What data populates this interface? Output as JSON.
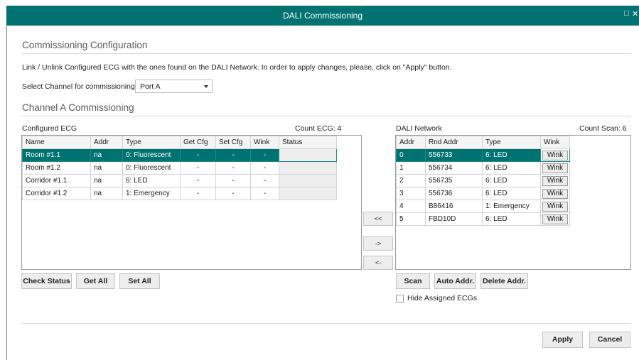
{
  "window": {
    "title": "DALI Commissioning",
    "maximize_icon": "□",
    "close_icon": "✕"
  },
  "config": {
    "heading": "Commissioning Configuration",
    "description": "Link / Unlink Configured ECG with the ones found on the DALI Network. In order to apply changes, please, click on \"Apply\" button.",
    "channel_label": "Select Channel for commissioning",
    "channel_value": "Port A"
  },
  "channel": {
    "heading": "Channel A Commissioning"
  },
  "configured": {
    "title": "Configured ECG",
    "count": "Count ECG: 4",
    "columns": [
      "Name",
      "Addr",
      "Type",
      "Get Cfg",
      "Set Cfg",
      "Wink",
      "Status"
    ],
    "rows": [
      [
        "Room #1.1",
        "na",
        "0: Fluorescent",
        "-",
        "-",
        "-",
        ""
      ],
      [
        "Room #1.2",
        "na",
        "0: Fluorescent",
        "-",
        "-",
        "-",
        ""
      ],
      [
        "Corridor #1.1",
        "na",
        "6: LED",
        "-",
        "-",
        "-",
        ""
      ],
      [
        "Corridor #1.2",
        "na",
        "1: Emergency",
        "-",
        "-",
        "-",
        ""
      ]
    ]
  },
  "network": {
    "title": "DALI Network",
    "count": "Count Scan: 6",
    "columns": [
      "Addr",
      "Rnd Addr",
      "Type",
      "Wink"
    ],
    "wink_label": "Wink",
    "rows": [
      [
        "0",
        "556733",
        "6: LED"
      ],
      [
        "1",
        "556734",
        "6: LED"
      ],
      [
        "2",
        "556735",
        "6: LED"
      ],
      [
        "3",
        "556736",
        "6: LED"
      ],
      [
        "4",
        "B86416",
        "1: Emergency"
      ],
      [
        "5",
        "FBD10D",
        "6: LED"
      ]
    ]
  },
  "transfer": {
    "link_all": "<<",
    "link": "->",
    "unlink": "<-"
  },
  "left_buttons": {
    "check_status": "Check Status",
    "get_all": "Get All",
    "set_all": "Set All"
  },
  "right_buttons": {
    "scan": "Scan",
    "auto_addr": "Auto Addr.",
    "delete_addr": "Delete Addr."
  },
  "hide_assigned": "Hide Assigned ECGs",
  "footer": {
    "apply": "Apply",
    "cancel": "Cancel"
  },
  "colors": {
    "accent": "#007272"
  }
}
